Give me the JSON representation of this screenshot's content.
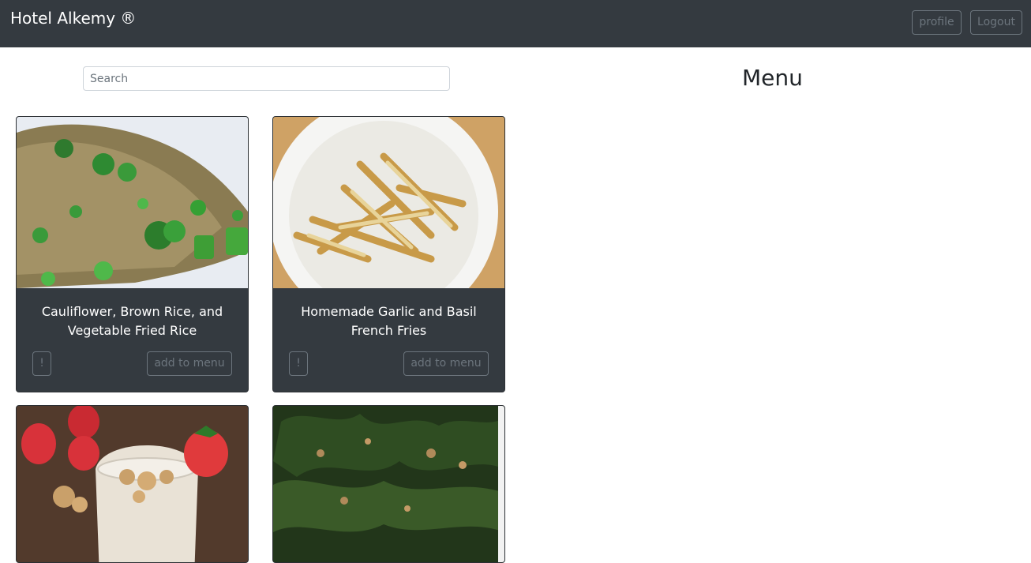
{
  "navbar": {
    "brand": "Hotel Alkemy ®",
    "profile_label": "profile",
    "logout_label": "Logout"
  },
  "search": {
    "placeholder": "Search"
  },
  "menu": {
    "title": "Menu"
  },
  "dishes": [
    {
      "title": "Cauliflower, Brown Rice, and Vegetable Fried Rice",
      "info_label": "!",
      "add_label": "add to menu"
    },
    {
      "title": "Homemade Garlic and Basil French Fries",
      "info_label": "!",
      "add_label": "add to menu"
    },
    {
      "title": "",
      "info_label": "",
      "add_label": ""
    },
    {
      "title": "",
      "info_label": "",
      "add_label": ""
    }
  ],
  "colors": {
    "navbar_bg": "#343a40",
    "card_bg": "#343a40",
    "button_outline": "#6c757d"
  }
}
